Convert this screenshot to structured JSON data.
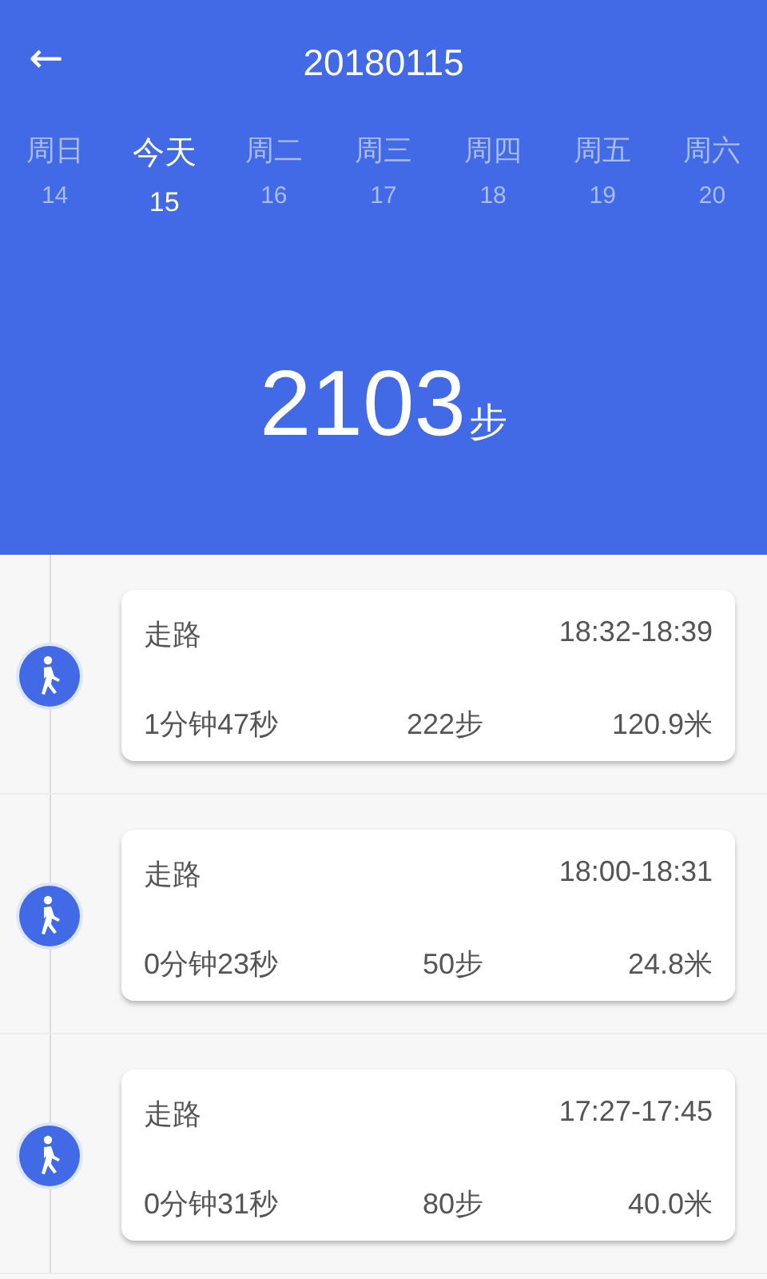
{
  "header": {
    "back": "←",
    "title": "20180115"
  },
  "days": [
    {
      "name": "周日",
      "date": "14",
      "selected": false
    },
    {
      "name": "今天",
      "date": "15",
      "selected": true
    },
    {
      "name": "周二",
      "date": "16",
      "selected": false
    },
    {
      "name": "周三",
      "date": "17",
      "selected": false
    },
    {
      "name": "周四",
      "date": "18",
      "selected": false
    },
    {
      "name": "周五",
      "date": "19",
      "selected": false
    },
    {
      "name": "周六",
      "date": "20",
      "selected": false
    }
  ],
  "total": {
    "steps": "2103",
    "unit": "步"
  },
  "activities": [
    {
      "type": "走路",
      "time": "18:32-18:39",
      "duration": "1分钟47秒",
      "steps": "222步",
      "distance": "120.9米"
    },
    {
      "type": "走路",
      "time": "18:00-18:31",
      "duration": "0分钟23秒",
      "steps": "50步",
      "distance": "24.8米"
    },
    {
      "type": "走路",
      "time": "17:27-17:45",
      "duration": "0分钟31秒",
      "steps": "80步",
      "distance": "40.0米"
    }
  ]
}
